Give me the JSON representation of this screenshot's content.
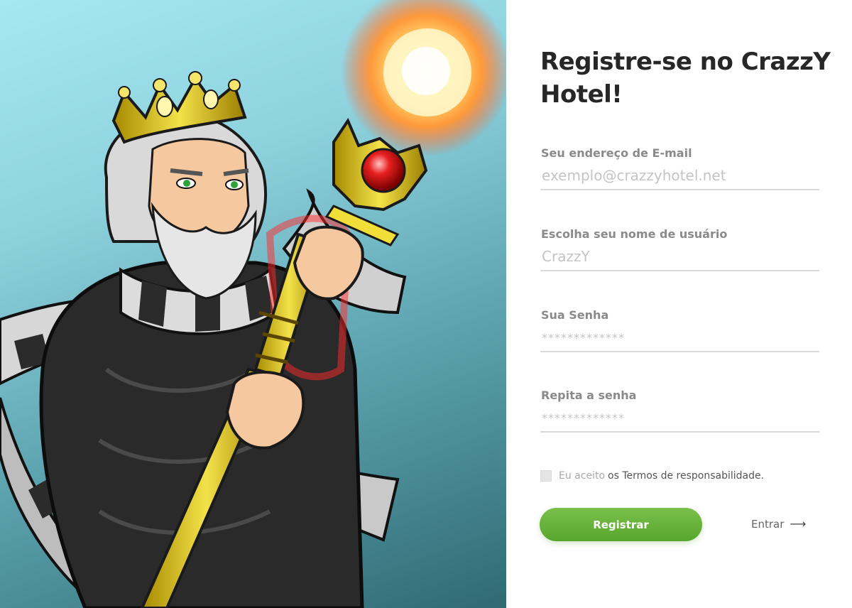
{
  "form": {
    "title": "Registre-se no CrazzY Hotel!",
    "email": {
      "label": "Seu endereço de E-mail",
      "placeholder": "exemplo@crazzyhotel.net"
    },
    "username": {
      "label": "Escolha seu nome de usuário",
      "placeholder": "CrazzY"
    },
    "password": {
      "label": "Sua Senha",
      "placeholder": "*************"
    },
    "password_repeat": {
      "label": "Repita a senha",
      "placeholder": "*************"
    },
    "terms": {
      "prefix": "Eu aceito",
      "link": "os Termos de responsabilidade."
    },
    "register_button": "Registrar",
    "login_link": "Entrar"
  },
  "icons": {
    "login_arrow": "arrow-right-icon"
  },
  "colors": {
    "accent": "#66b33a",
    "title": "#272727",
    "label": "#8a8a8a",
    "hero_sky": "#a6e8f2",
    "hero_deep": "#2f6a73"
  }
}
